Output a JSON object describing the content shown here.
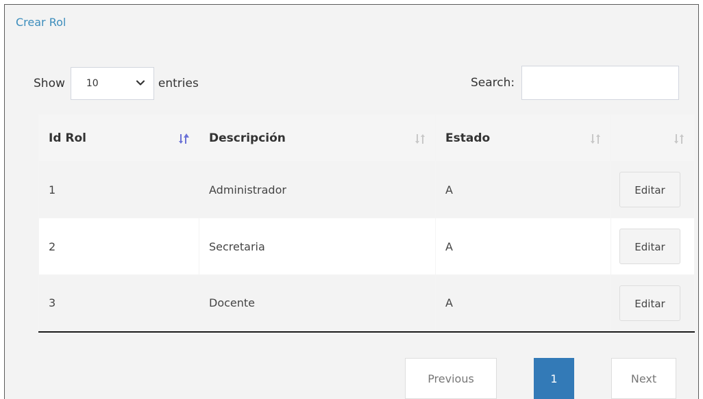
{
  "header": {
    "create_link": "Crear Rol"
  },
  "length_control": {
    "show_label": "Show",
    "selected_value": "10",
    "entries_label": "entries"
  },
  "search": {
    "label": "Search:",
    "value": ""
  },
  "table": {
    "columns": [
      "Id Rol",
      "Descripción",
      "Estado",
      ""
    ],
    "rows": [
      {
        "id": "1",
        "descripcion": "Administrador",
        "estado": "A",
        "action": "Editar"
      },
      {
        "id": "2",
        "descripcion": "Secretaria",
        "estado": "A",
        "action": "Editar"
      },
      {
        "id": "3",
        "descripcion": "Docente",
        "estado": "A",
        "action": "Editar"
      }
    ]
  },
  "pagination": {
    "previous": "Previous",
    "current_page": "1",
    "next": "Next"
  },
  "icons": {
    "sort_active": "sort-asc-icon",
    "sort_inactive": "sort-both-icon",
    "dropdown": "chevron-down-icon"
  },
  "colors": {
    "link": "#3c8dbc",
    "page_active": "#337ab7",
    "sort_active": "#6b72d6",
    "sort_inactive": "#c8c8c8"
  }
}
